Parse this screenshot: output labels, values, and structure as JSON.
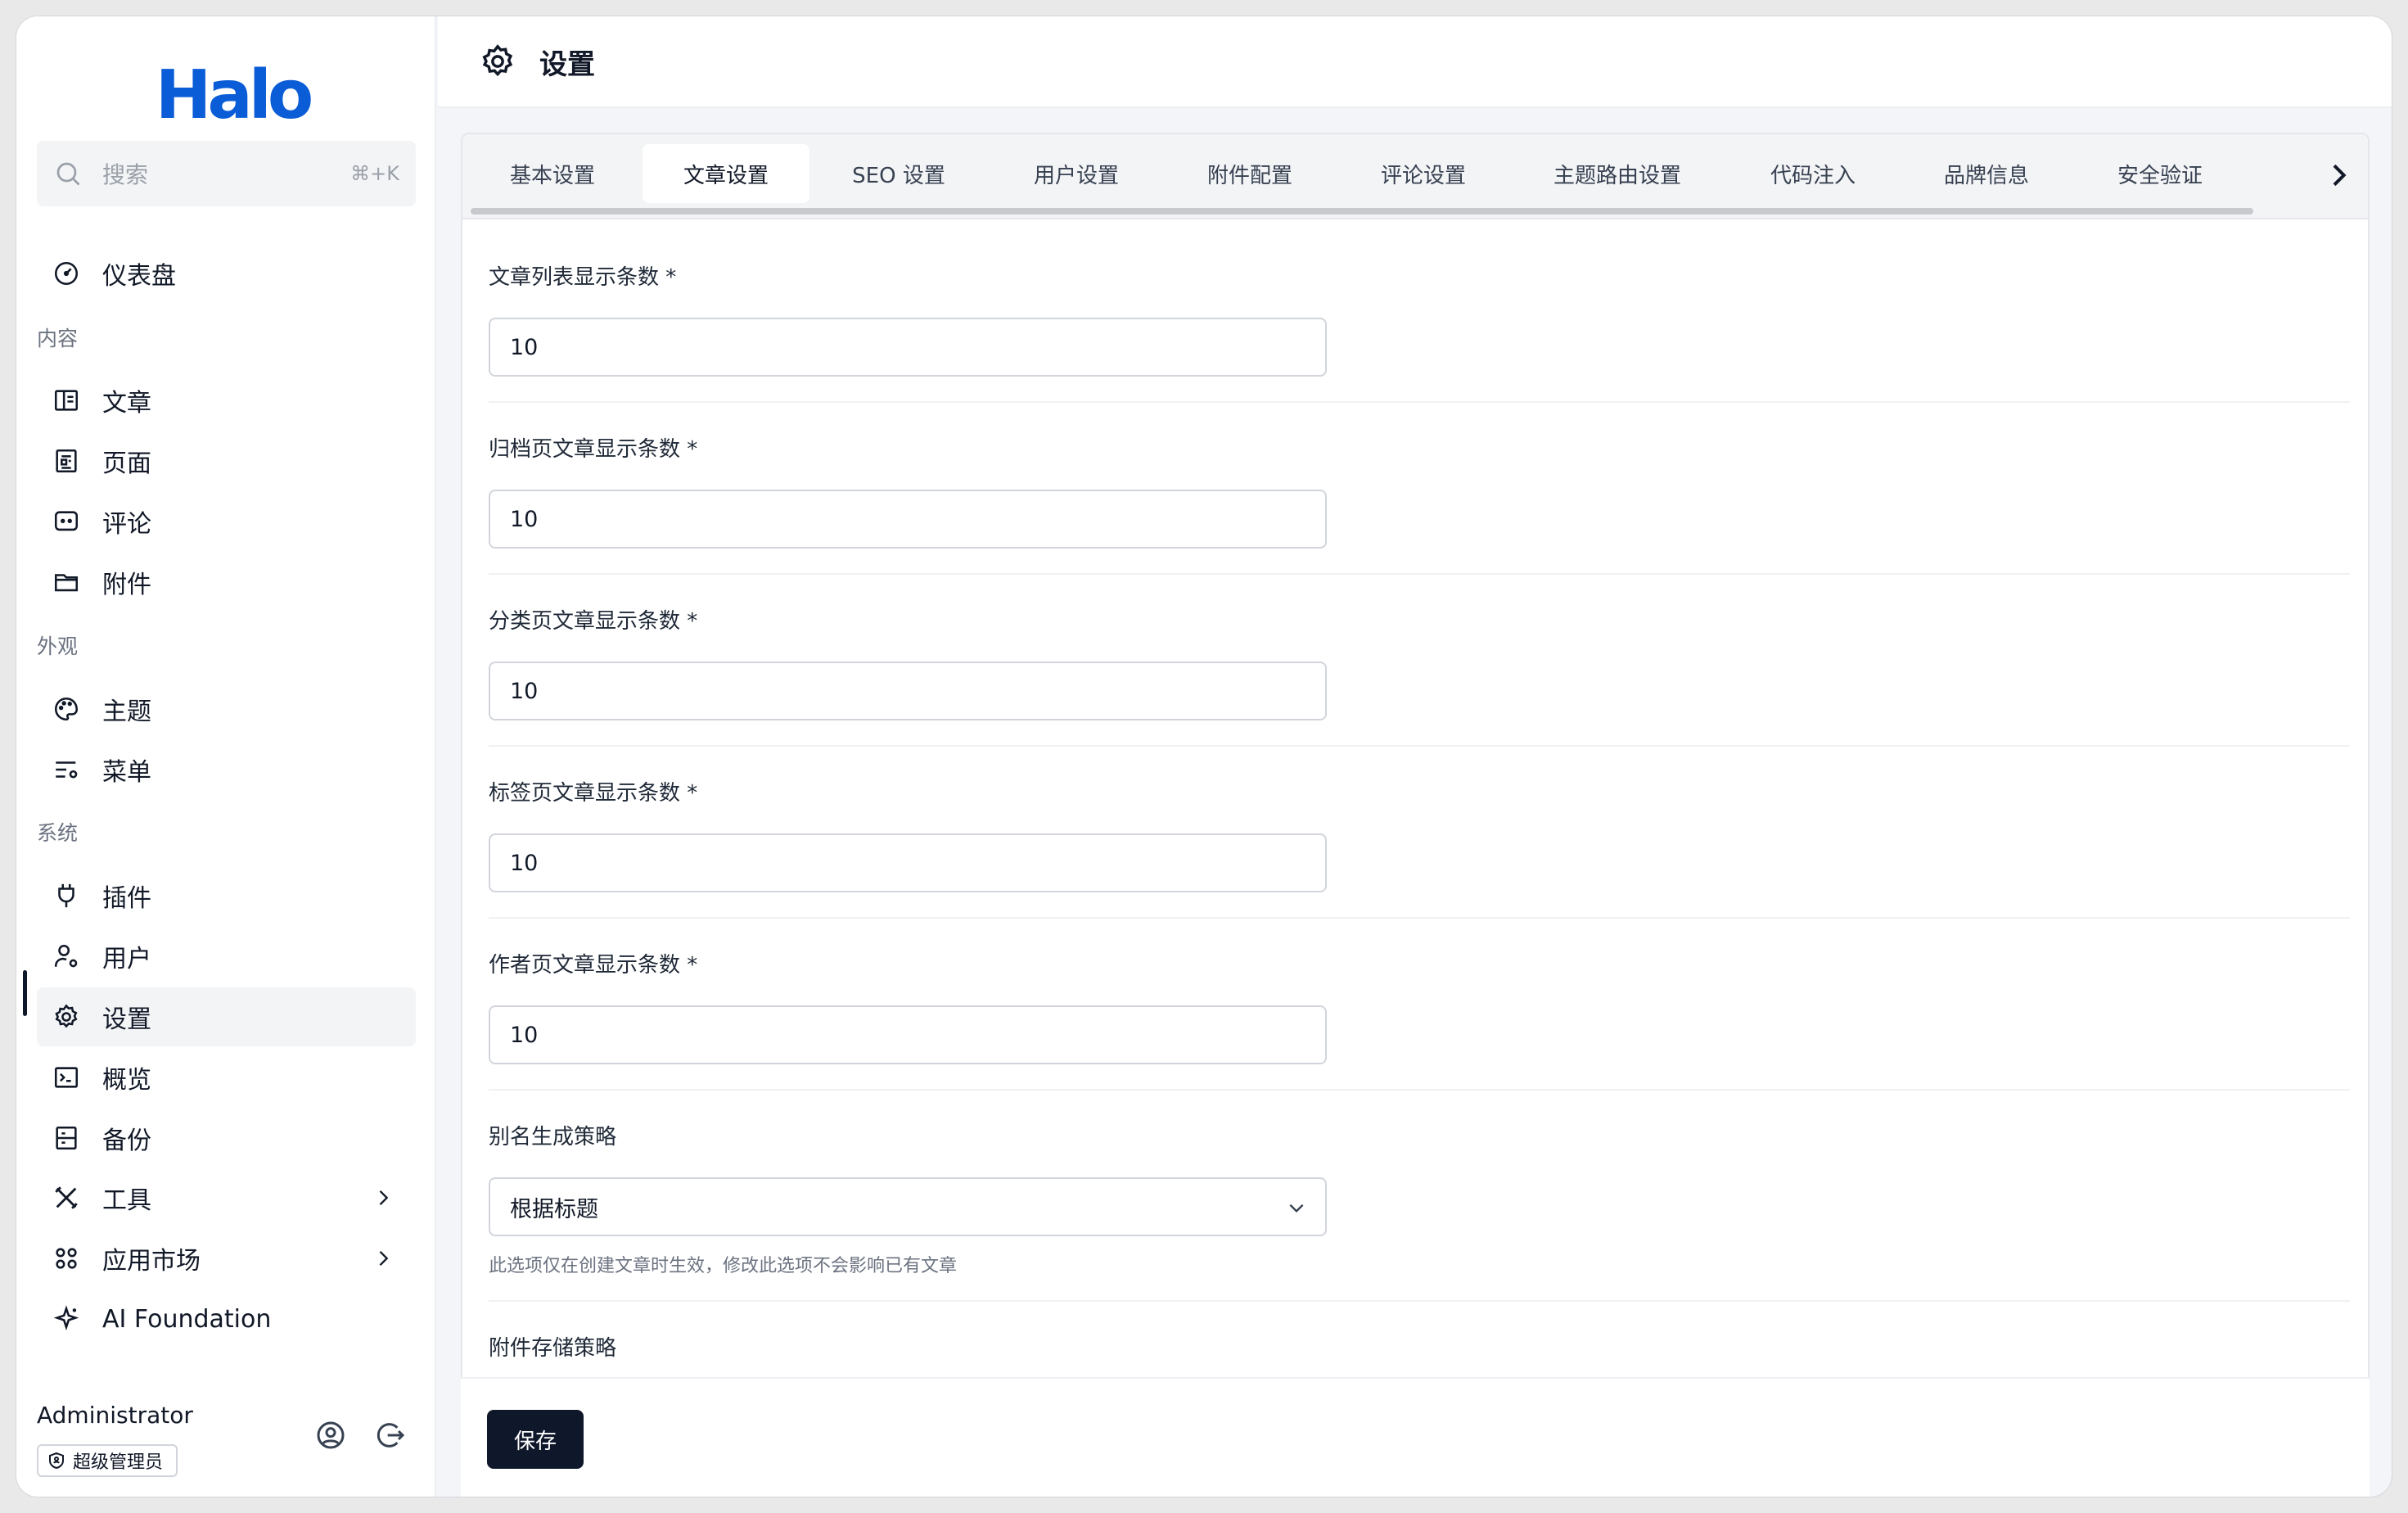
{
  "app": {
    "logo": "Halo"
  },
  "search": {
    "placeholder": "搜索",
    "shortcut": "⌘+K"
  },
  "sidebar": {
    "dashboard": "仪表盘",
    "groups": {
      "content": "内容",
      "appearance": "外观",
      "system": "系统"
    },
    "items": {
      "posts": "文章",
      "pages": "页面",
      "comments": "评论",
      "attachments": "附件",
      "themes": "主题",
      "menus": "菜单",
      "plugins": "插件",
      "users": "用户",
      "settings": "设置",
      "overview": "概览",
      "backup": "备份",
      "tools": "工具",
      "marketplace": "应用市场",
      "ai": "AI Foundation"
    },
    "active": "settings"
  },
  "user": {
    "name": "Administrator",
    "role": "超级管理员"
  },
  "header": {
    "title": "设置",
    "icon": "gear-icon"
  },
  "tabs": [
    {
      "label": "基本设置"
    },
    {
      "label": "文章设置",
      "active": true
    },
    {
      "label": "SEO 设置"
    },
    {
      "label": "用户设置"
    },
    {
      "label": "附件配置"
    },
    {
      "label": "评论设置"
    },
    {
      "label": "主题路由设置"
    },
    {
      "label": "代码注入"
    },
    {
      "label": "品牌信息"
    },
    {
      "label": "安全验证"
    }
  ],
  "form": {
    "fields": [
      {
        "label": "文章列表显示条数 *",
        "value": "10"
      },
      {
        "label": "归档页文章显示条数 *",
        "value": "10"
      },
      {
        "label": "分类页文章显示条数 *",
        "value": "10"
      },
      {
        "label": "标签页文章显示条数 *",
        "value": "10"
      },
      {
        "label": "作者页文章显示条数 *",
        "value": "10"
      }
    ],
    "slug_strategy": {
      "label": "别名生成策略",
      "value": "根据标题",
      "help": "此选项仅在创建文章时生效，修改此选项不会影响已有文章"
    },
    "attachment_policy": {
      "label": "附件存储策略"
    }
  },
  "actions": {
    "save": "保存"
  },
  "colors": {
    "brand": "#0b5cd7",
    "primary_button": "#0f172a"
  }
}
